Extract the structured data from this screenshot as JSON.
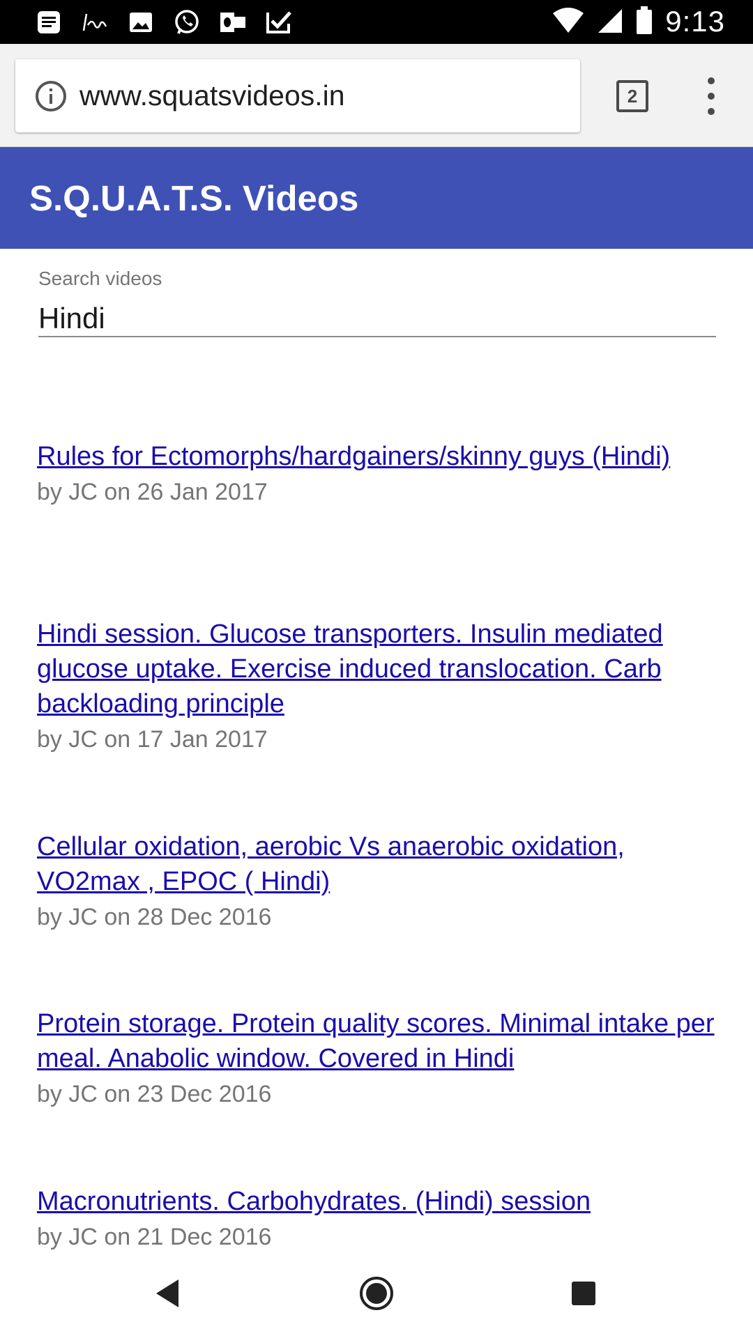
{
  "status_bar": {
    "time": "9:13",
    "left_icons": [
      "news-icon",
      "isha-app-icon",
      "image-icon",
      "whatsapp-icon",
      "outlook-icon",
      "tasks-check-icon"
    ],
    "right_icons": [
      "wifi-icon",
      "cell-signal-icon",
      "battery-icon"
    ]
  },
  "browser": {
    "url": "www.squatsvideos.in",
    "tab_count": "2"
  },
  "app": {
    "title": "S.Q.U.A.T.S. Videos"
  },
  "search": {
    "label": "Search videos",
    "value": "Hindi"
  },
  "results": [
    {
      "title": "Rules for Ectomorphs/hardgainers/skinny guys (Hindi)",
      "meta": "by JC on 26 Jan 2017"
    },
    {
      "title": "Hindi session. Glucose transporters. Insulin mediated glucose uptake. Exercise induced translocation. Carb backloading principle",
      "meta": "by JC on 17 Jan 2017"
    },
    {
      "title": "Cellular oxidation, aerobic Vs anaerobic oxidation, VO2max , EPOC ( Hindi)",
      "meta": "by JC on 28 Dec 2016"
    },
    {
      "title": "Protein storage. Protein quality scores. Minimal intake per meal. Anabolic window. Covered in Hindi",
      "meta": "by JC on 23 Dec 2016"
    },
    {
      "title": "Macronutrients. Carbohydrates. (Hindi) session",
      "meta": "by JC on 21 Dec 2016"
    }
  ],
  "colors": {
    "app_bar": "#3f51b5",
    "link": "#1a0dab",
    "meta": "#757575"
  },
  "nav_bar": {
    "buttons": [
      "back-icon",
      "home-icon",
      "recents-icon"
    ]
  }
}
